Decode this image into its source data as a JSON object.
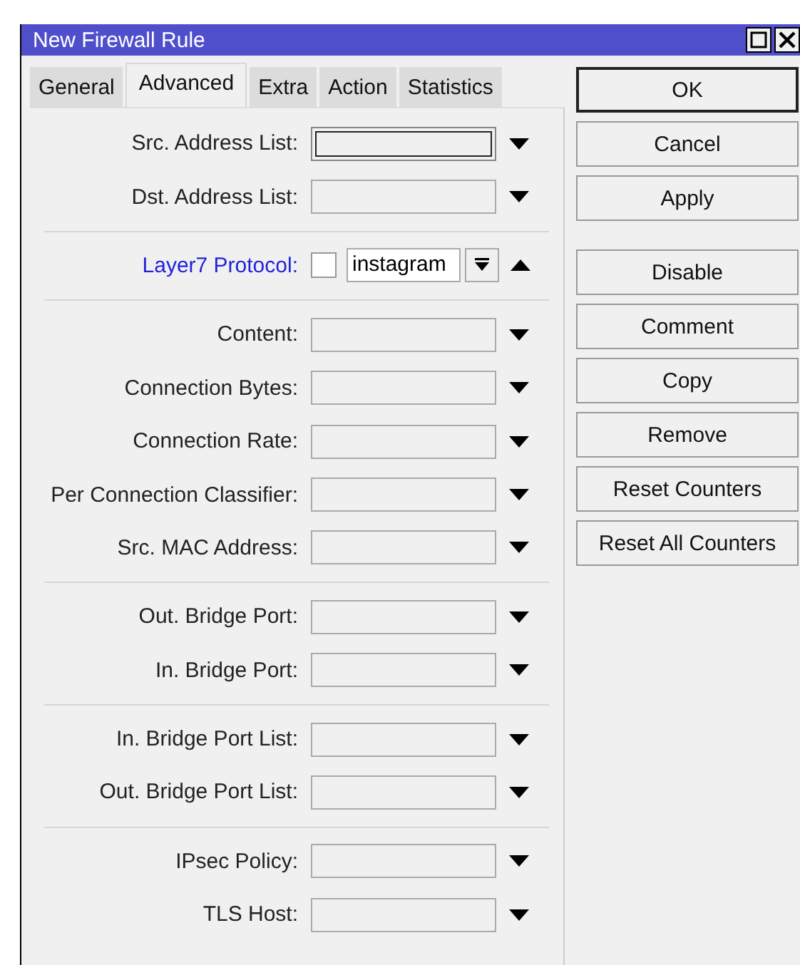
{
  "window": {
    "title": "New Firewall Rule"
  },
  "tabs": [
    {
      "label": "General",
      "selected": false
    },
    {
      "label": "Advanced",
      "selected": true
    },
    {
      "label": "Extra",
      "selected": false
    },
    {
      "label": "Action",
      "selected": false
    },
    {
      "label": "Statistics",
      "selected": false
    }
  ],
  "groups": [
    [
      {
        "label": "Src. Address List:",
        "kind": "combo",
        "focused": true,
        "active": false
      },
      {
        "label": "Dst. Address List:",
        "kind": "combo",
        "focused": false,
        "active": false
      }
    ],
    [
      {
        "label": "Layer7 Protocol:",
        "kind": "layer7",
        "focused": false,
        "active": true,
        "checked": false,
        "value": "instagram"
      }
    ],
    [
      {
        "label": "Content:",
        "kind": "combo",
        "focused": false,
        "active": false
      },
      {
        "label": "Connection Bytes:",
        "kind": "combo",
        "focused": false,
        "active": false
      },
      {
        "label": "Connection Rate:",
        "kind": "combo",
        "focused": false,
        "active": false
      },
      {
        "label": "Per Connection Classifier:",
        "kind": "combo",
        "focused": false,
        "active": false
      },
      {
        "label": "Src. MAC Address:",
        "kind": "combo",
        "focused": false,
        "active": false
      }
    ],
    [
      {
        "label": "Out. Bridge Port:",
        "kind": "combo",
        "focused": false,
        "active": false
      },
      {
        "label": "In. Bridge Port:",
        "kind": "combo",
        "focused": false,
        "active": false
      }
    ],
    [
      {
        "label": "In. Bridge Port List:",
        "kind": "combo",
        "focused": false,
        "active": false
      },
      {
        "label": "Out. Bridge Port List:",
        "kind": "combo",
        "focused": false,
        "active": false
      }
    ],
    [
      {
        "label": "IPsec Policy:",
        "kind": "combo",
        "focused": false,
        "active": false
      },
      {
        "label": "TLS Host:",
        "kind": "combo",
        "focused": false,
        "active": false
      }
    ]
  ],
  "buttons": [
    {
      "label": "OK",
      "default": true
    },
    {
      "label": "Cancel",
      "default": false
    },
    {
      "label": "Apply",
      "default": false
    },
    {
      "label": "Disable",
      "default": false
    },
    {
      "label": "Comment",
      "default": false
    },
    {
      "label": "Copy",
      "default": false
    },
    {
      "label": "Remove",
      "default": false
    },
    {
      "label": "Reset Counters",
      "default": false
    },
    {
      "label": "Reset All Counters",
      "default": false
    }
  ]
}
